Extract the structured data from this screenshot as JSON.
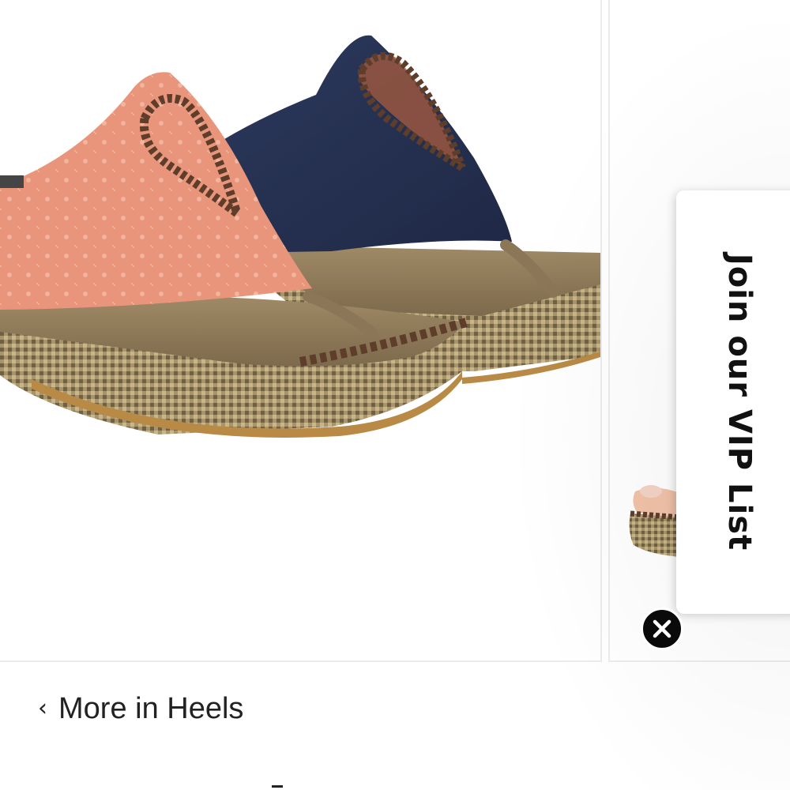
{
  "carousel": {
    "main_image": {
      "alt": "",
      "colors": {
        "coral_sandal": "#e79a7e",
        "navy_sandal": "#2a3555",
        "footbed": "#8b7a5e",
        "woven_sole": "#a89468",
        "stitching": "#5a3a28"
      }
    },
    "next_image": {
      "alt": ""
    }
  },
  "vip": {
    "label": "Join our VIP List",
    "close_icon": "close-icon"
  },
  "breadcrumb_link": {
    "chevron": "‹",
    "label": "More in Heels"
  }
}
